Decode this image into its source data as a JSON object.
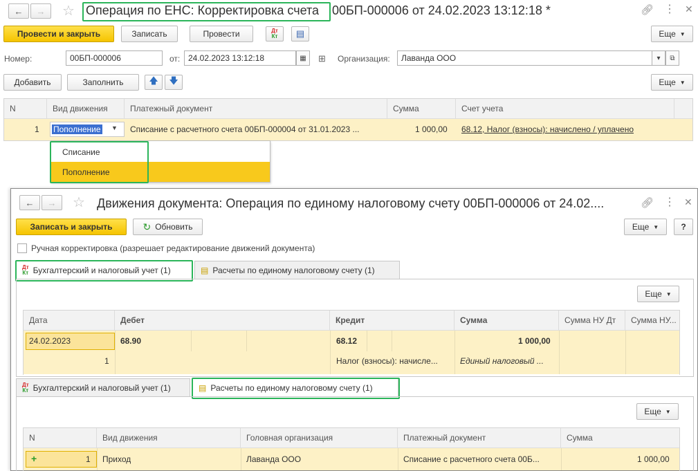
{
  "main_window": {
    "title": "Операция по ЕНС: Корректировка счета",
    "title_suffix": "00БП-000006 от 24.02.2023 13:12:18 *",
    "toolbar": {
      "post_close": "Провести и закрыть",
      "write": "Записать",
      "post": "Провести",
      "dtkt_dt": "Дт",
      "dtkt_kt": "Кт",
      "more": "Еще"
    },
    "form": {
      "number_label": "Номер:",
      "number_value": "00БП-000006",
      "date_label": "от:",
      "date_value": "24.02.2023 13:12:18",
      "org_label": "Организация:",
      "org_value": "Лаванда ООО"
    },
    "table_toolbar": {
      "add": "Добавить",
      "fill": "Заполнить",
      "more": "Еще"
    },
    "table": {
      "columns": [
        "N",
        "Вид движения",
        "Платежный документ",
        "Сумма",
        "Счет учета"
      ],
      "row": {
        "n": "1",
        "kind": "Пополнение",
        "doc": "Списание с расчетного счета 00БП-000004 от 31.01.2023 ...",
        "sum": "1 000,00",
        "account": "68.12, Налог (взносы): начислено / уплачено"
      }
    },
    "dropdown": {
      "options": [
        "Списание",
        "Пополнение"
      ],
      "selected": "Пополнение"
    }
  },
  "movements_window": {
    "title": "Движения документа: Операция по единому налоговому счету 00БП-000006 от 24.02....",
    "toolbar": {
      "write_close": "Записать и закрыть",
      "refresh": "Обновить",
      "more": "Еще",
      "help": "?"
    },
    "manual_checkbox_label": "Ручная корректировка (разрешает редактирование движений документа)",
    "tabs": [
      "Бухгалтерский и налоговый учет (1)",
      "Расчеты по единому налоговому счету (1)"
    ],
    "more": "Еще",
    "acc_table": {
      "columns": [
        "Дата",
        "Дебет",
        "Кредит",
        "Сумма",
        "Сумма НУ Дт",
        "Сумма НУ..."
      ],
      "row": {
        "date": "24.02.2023",
        "n": "1",
        "debit": "68.90",
        "credit": "68.12",
        "credit_sub": "Налог (взносы): начисле...",
        "sum": "1 000,00",
        "sum_sub": "Единый налоговый ..."
      }
    },
    "ens_table": {
      "columns": [
        "N",
        "Вид движения",
        "Головная организация",
        "Платежный документ",
        "Сумма"
      ],
      "row": {
        "n": "1",
        "kind": "Приход",
        "org": "Лаванда ООО",
        "doc": "Списание с расчетного счета 00Б...",
        "sum": "1 000,00"
      }
    }
  }
}
